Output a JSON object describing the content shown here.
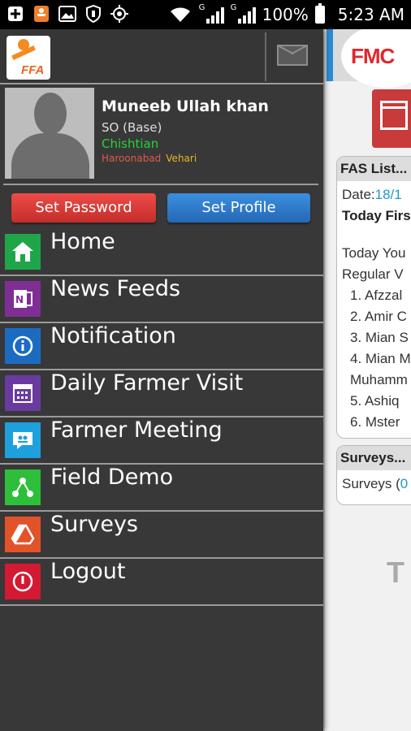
{
  "status_bar": {
    "battery": "100%",
    "time": "5:23 AM",
    "signal1_label": "G",
    "signal2_label": "G"
  },
  "header": {
    "logo_text": "FFA"
  },
  "profile": {
    "name": "Muneeb Ullah khan",
    "role": "SO (Base)",
    "city": "Chishtian",
    "area1": "Haroonabad",
    "area2": "Vehari"
  },
  "buttons": {
    "set_password": "Set Password",
    "set_profile": "Set Profile"
  },
  "menu": [
    {
      "label": "Home",
      "icon": "home-icon",
      "color": "#1fa64a"
    },
    {
      "label": "News Feeds",
      "icon": "onenote-icon",
      "color": "#7f2f93"
    },
    {
      "label": "Notification",
      "icon": "info-icon",
      "color": "#1b6cc1"
    },
    {
      "label": "Daily Farmer Visit",
      "icon": "calendar-icon",
      "color": "#6b3aa0"
    },
    {
      "label": "Farmer Meeting",
      "icon": "chat-icon",
      "color": "#1ea0dc"
    },
    {
      "label": "Field Demo",
      "icon": "network-icon",
      "color": "#2dbf3a"
    },
    {
      "label": "Surveys",
      "icon": "drive-icon",
      "color": "#e2532a"
    },
    {
      "label": "Logout",
      "icon": "power-icon",
      "color": "#d31a32"
    }
  ],
  "background_screen": {
    "logo_text": "FMC",
    "fas_title": "FAS List...",
    "date_label": "Date:",
    "date_value": "18/1",
    "today_first": "Today Firs",
    "today_you": "Today You",
    "regular": "Regular V",
    "list": [
      "1. Afzzal",
      "2. Amir C",
      "3. Mian S",
      "4. Mian M",
      "Muhamm",
      "5. Ashiq",
      "6. Mster"
    ],
    "surveys_title": "Surveys...",
    "surveys_line": "Surveys (",
    "surveys_count": "0",
    "big_text": "T"
  }
}
